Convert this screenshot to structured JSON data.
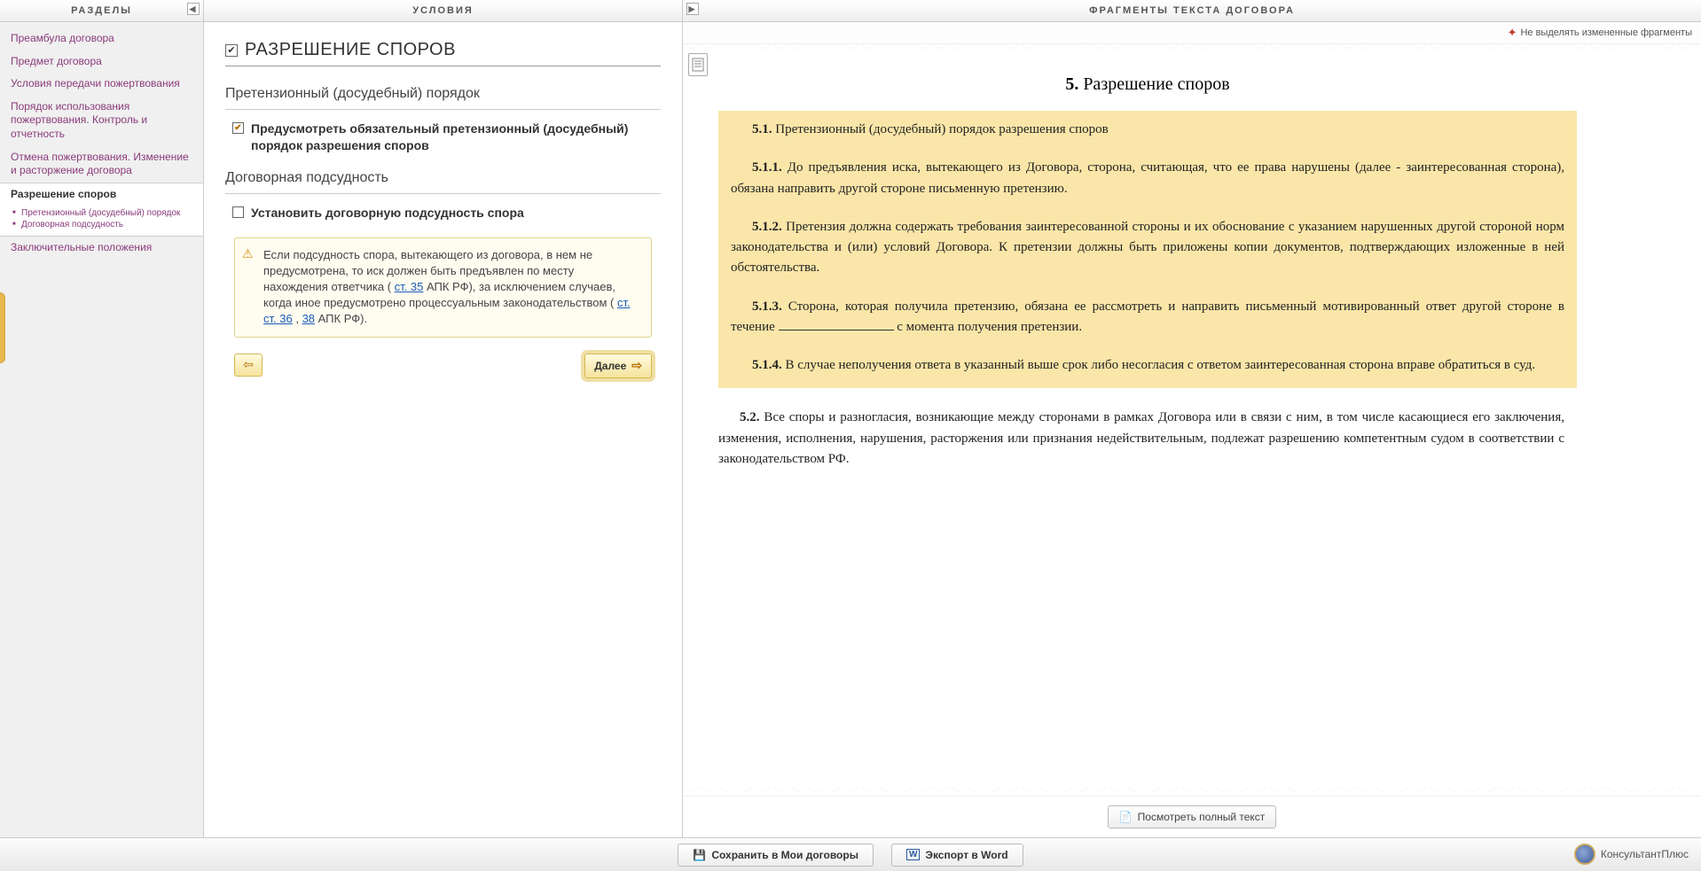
{
  "headers": {
    "left": "РАЗДЕЛЫ",
    "middle": "УСЛОВИЯ",
    "right": "ФРАГМЕНТЫ ТЕКСТА ДОГОВОРА"
  },
  "sidebar": {
    "items": [
      {
        "label": "Преамбула договора"
      },
      {
        "label": "Предмет договора"
      },
      {
        "label": "Условия  передачи пожертвования"
      },
      {
        "label": "Порядок использования пожертвования. Контроль и отчетность"
      },
      {
        "label": "Отмена пожертвования. Изменение и расторжение договора"
      },
      {
        "label": "Разрешение споров",
        "active": true,
        "children": [
          {
            "label": "Претензионный (досудебный) порядок"
          },
          {
            "label": "Договорная подсудность"
          }
        ]
      },
      {
        "label": "Заключительные положения"
      }
    ]
  },
  "conditions": {
    "title": "РАЗРЕШЕНИЕ СПОРОВ",
    "sub1": "Претензионный (досудебный) порядок",
    "opt1_checked": true,
    "opt1_label": "Предусмотреть обязательный претензионный (досудебный) порядок разрешения споров",
    "sub2": "Договорная подсудность",
    "opt2_checked": false,
    "opt2_label": "Установить договорную подсудность спора",
    "note_pre": "Если подсудность спора, вытекающего из договора, в нем не предусмотрена, то иск должен быть предъявлен по месту нахождения ответчика ( ",
    "note_link1": "ст. 35",
    "note_mid1": " АПК РФ), за исключением случаев, когда иное предусмотрено процессуальным законодательством ( ",
    "note_link2": "ст. ст. 36",
    "note_sep": ", ",
    "note_link3": "38",
    "note_post": " АПК РФ).",
    "back_label": "Назад",
    "next_label": "Далее"
  },
  "right": {
    "toggle_highlight": "Не выделять измененные фрагменты",
    "doc_title_num": "5.",
    "doc_title_text": " Разрешение споров",
    "c51n": "5.1.",
    "c51": " Претензионный (досудебный) порядок разрешения споров",
    "c511n": "5.1.1.",
    "c511": " До предъявления иска, вытекающего из Договора, сторона, считающая, что ее права нарушены (далее - заинтересованная сторона), обязана направить другой стороне письменную претензию.",
    "c512n": "5.1.2.",
    "c512": " Претензия должна содержать требования заинтересованной стороны и их обоснование с указанием нарушенных другой стороной норм законодательства и (или) условий Договора. К претензии должны быть приложены копии документов, подтверждающих изложенные в ней обстоятельства.",
    "c513n": "5.1.3.",
    "c513a": " Сторона, которая получила претензию, обязана ее рассмотреть и направить письменный мотивированный ответ другой стороне в течение ",
    "c513b": " с момента получения претензии.",
    "c514n": "5.1.4.",
    "c514": " В случае неполучения ответа в указанный выше срок либо несогласия с ответом заинтересованная сторона вправе обратиться в суд.",
    "c52n": "5.2.",
    "c52": " Все споры и разногласия, возникающие между сторонами в рамках Договора или в связи с ним, в том числе касающиеся его заключения, изменения, исполнения, нарушения, расторжения или признания недействительным, подлежат разрешению компетентным судом в соответствии с законодательством РФ.",
    "view_full": "Посмотреть полный текст"
  },
  "bottom": {
    "save": "Сохранить в Мои договоры",
    "export": "Экспорт в Word",
    "brand": "КонсультантПлюс"
  }
}
